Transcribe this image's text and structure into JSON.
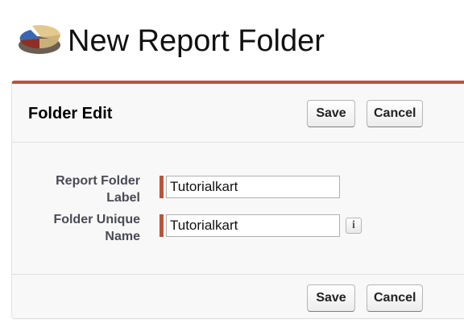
{
  "header": {
    "title": "New Report Folder",
    "icon": "report-folder-icon"
  },
  "panel": {
    "title": "Folder Edit",
    "accent_color": "#b9553b",
    "buttons": {
      "save_label": "Save",
      "cancel_label": "Cancel"
    }
  },
  "form": {
    "fields": [
      {
        "label_line1": "Report Folder",
        "label_line2": "Label",
        "value": "Tutorialkart",
        "required": true
      },
      {
        "label_line1": "Folder Unique",
        "label_line2": "Name",
        "value": "Tutorialkart",
        "required": true,
        "help_icon": "info-icon",
        "help_glyph": "i"
      }
    ]
  },
  "footer": {
    "save_label": "Save",
    "cancel_label": "Cancel"
  }
}
